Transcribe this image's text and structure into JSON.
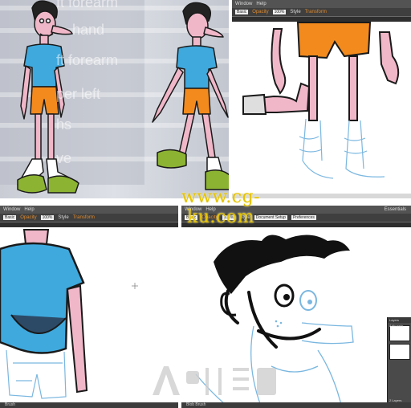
{
  "panel_top_left": {
    "menu_items": [
      "ft forearm",
      "hand",
      "ft forearm",
      "per left",
      "hs",
      "ve"
    ]
  },
  "panel_top_right": {
    "menu": [
      "Window",
      "Help"
    ],
    "fields": [
      "Basic",
      "Opacity",
      "100%",
      "Style",
      "Transform"
    ]
  },
  "panel_bottom_left": {
    "menu": [
      "Window",
      "Help"
    ],
    "fields": [
      "Basic",
      "Opacity",
      "100%",
      "Style",
      "Transform"
    ],
    "status": "Brush"
  },
  "panel_bottom_right": {
    "menu": [
      "Window",
      "Help"
    ],
    "fields": [
      "Basic",
      "Opacity",
      "100%",
      "Style",
      "Document Setup",
      "Preferences"
    ],
    "right_label": "Essentials",
    "status": "Blob Brush",
    "layers": {
      "tabs": [
        "Layers",
        "Artboards"
      ],
      "footer": "2 Layers"
    }
  },
  "watermark": {
    "text": "www.cg-ku.com"
  },
  "colors": {
    "skin": "#f0b7c9",
    "shirt": "#3fa9dd",
    "shorts": "#f28a1e",
    "shoes": "#8cb332",
    "sketch": "#7ab7e0",
    "ui_dark": "#535353"
  }
}
